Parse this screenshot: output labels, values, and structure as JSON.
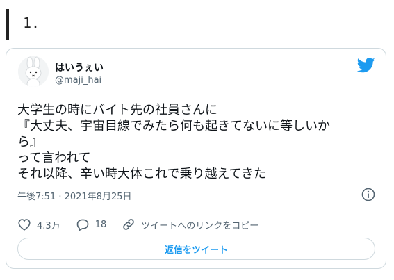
{
  "heading": {
    "number": "1."
  },
  "tweet": {
    "display_name": "はいうぇい",
    "handle": "@maji_hai",
    "text_lines": [
      "大学生の時にバイト先の社員さんに",
      "『大丈夫、宇宙目線でみたら何も起きてないに等しいか",
      "ら』",
      "って言われて",
      "それ以降、辛い時大体これで乗り越えてきた"
    ],
    "timestamp": "午後7:51 · 2021年8月25日",
    "likes": "4.3万",
    "replies": "18",
    "share_label": "ツイートへのリンクをコピー",
    "reply_button_label": "返信をツイート"
  },
  "icons": {
    "avatar": "miffy-avatar",
    "logo": "twitter-bird-icon",
    "info": "info-icon",
    "like": "heart-icon",
    "reply": "speech-bubble-icon",
    "link": "link-icon"
  },
  "colors": {
    "brand": "#1d9bf0",
    "text": "#0f1419",
    "muted": "#536471",
    "border": "#cfd9de"
  }
}
